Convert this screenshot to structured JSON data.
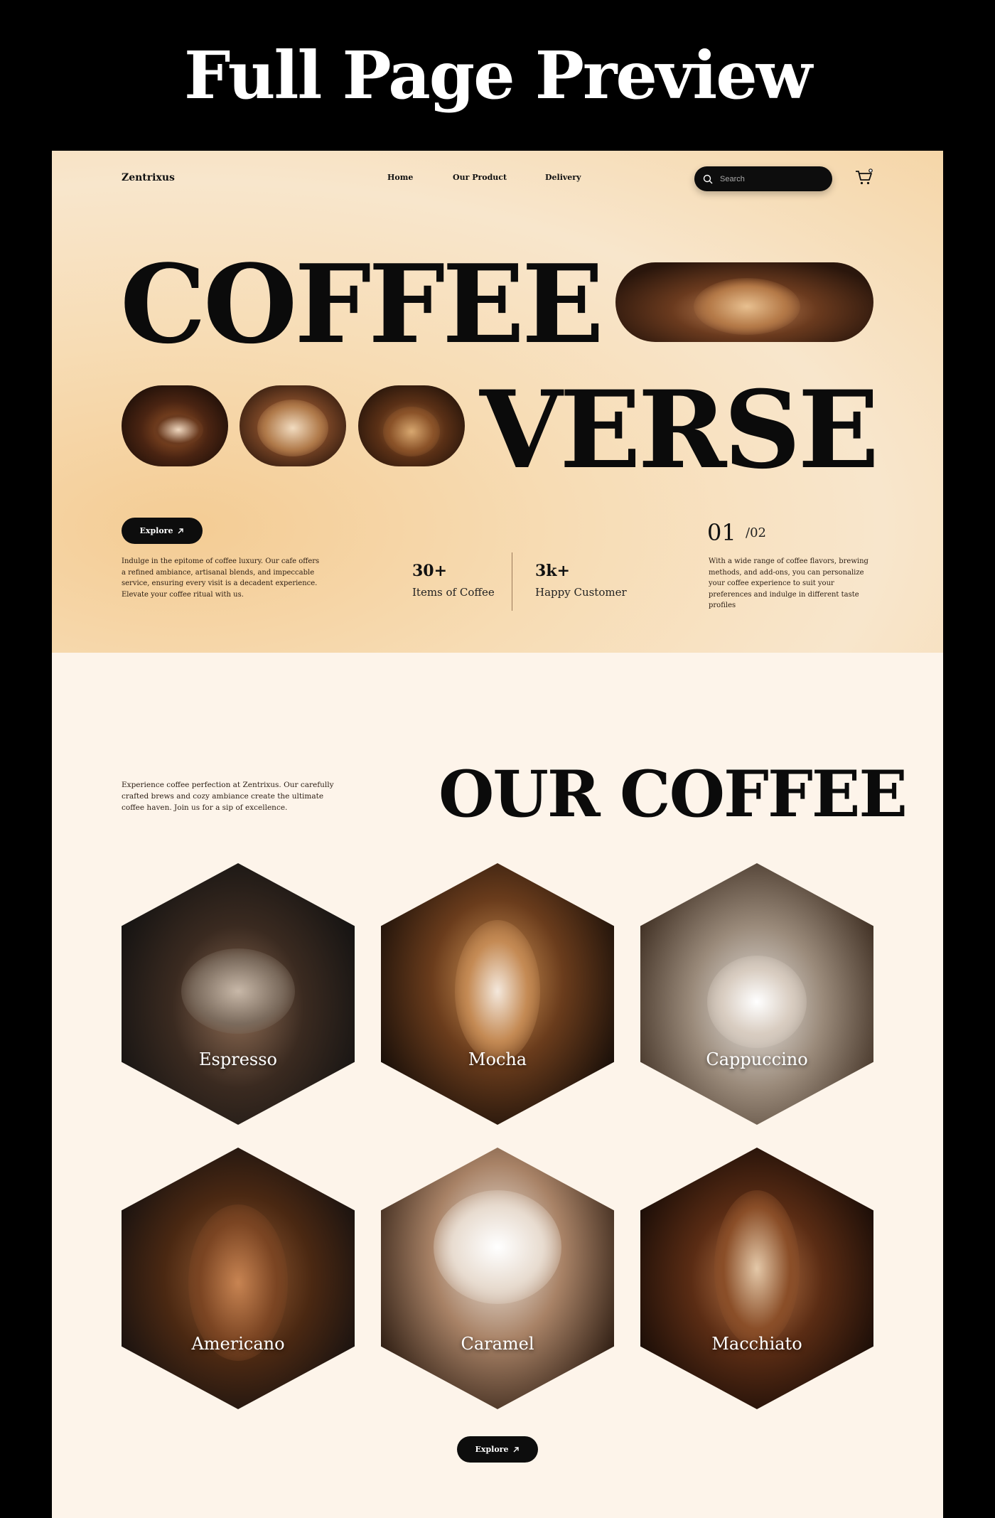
{
  "banner": {
    "title": "Full Page Preview"
  },
  "nav": {
    "brand": "Zentrixus",
    "links": [
      "Home",
      "Our Product",
      "Delivery"
    ],
    "search_placeholder": "Search"
  },
  "hero": {
    "word1": "COFFEE",
    "word2": "VERSE",
    "explore_label": "Explore",
    "intro": "Indulge in the epitome of coffee luxury. Our cafe offers a refined ambiance, artisanal blends, and impeccable service, ensuring every visit is a decadent experience. Elevate your coffee ritual with us.",
    "stats": [
      {
        "value": "30+",
        "label": "Items of Coffee"
      },
      {
        "value": "3k+",
        "label": "Happy Customer"
      }
    ],
    "page_current": "01",
    "page_total": "/02",
    "description": "With a wide range of coffee flavors, brewing methods, and add-ons, you can personalize your coffee experience to suit your preferences and indulge in different taste profiles"
  },
  "our_coffee": {
    "intro": "Experience coffee perfection at Zentrixus. Our carefully crafted brews and cozy ambiance create the ultimate coffee haven. Join us for a sip of excellence.",
    "title": "OUR COFFEE",
    "items": [
      "Espresso",
      "Mocha",
      "Cappuccino",
      "Americano",
      "Caramel",
      "Macchiato"
    ],
    "explore_label": "Explore"
  },
  "colors": {
    "accent": "#0d0d0d",
    "hero_bg": "#f7dcb4",
    "section_bg": "#fdf4ea"
  }
}
